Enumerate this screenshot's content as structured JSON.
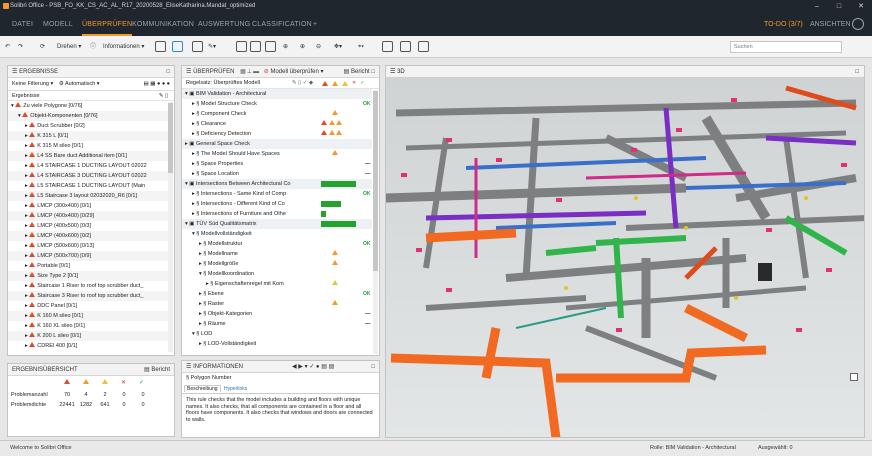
{
  "app_title": "Solibri Office - PSB_FO_KK_CS_AC_AL_R17_20200528_EliseKatharina.Mandat_optimized",
  "menu": {
    "tabs": [
      "DATEI",
      "MODELL",
      "ÜBERPRÜFEN",
      "KOMMUNIKATION",
      "AUSWERTUNG",
      "CLASSIFICATION",
      "+"
    ],
    "active": "ÜBERPRÜFEN",
    "todo": "TO-DO (3/7)",
    "ansichten": "ANSICHTEN"
  },
  "toolbar": {
    "drehen": "Drehen",
    "informationen": "Informationen",
    "search_placeholder": "Suchen"
  },
  "ergebnisse": {
    "title": "ERGEBNISSE",
    "filter": "Keine Filterung",
    "mode": "Automatisch",
    "header": "Ergebnisse",
    "rows": [
      "Zu viele Polygone [0/76]",
      "Objekt-Komponenten [0/76]",
      "Duct Scrubber [0/2]",
      "K 315 L [0/1]",
      "K 315 M sileo [0/1]",
      "L4 SS Bare duct Additional item [0/1]",
      "L4 STAIRCASE 1 DUCTING LAYOUT 02022",
      "L4 STAIRCASE 3 DUCTING LAYOUT 02022",
      "L5 STAIRCASE 1 DUCTING LAYOUT (Main",
      "L5 Staircase 3 layout 02032020_R6 [0/1]",
      "LMCP (300x400) [0/1]",
      "LMCP (400x400) [0/29]",
      "LMCP (400x500) [0/3]",
      "LMCP (400x600) [0/2]",
      "LMCP (500x600) [0/13]",
      "LMCP (500x700) [0/9]",
      "Portable [0/1]",
      "Size Type 2 [0/1]",
      "Staircase 1 Riser to roof top scrubber duct_",
      "Staircase 3 Riser to roof top scrubber duct_",
      "DDC Panel [0/1]",
      "K 160 M sileo [0/1]",
      "K 160 XL sileo [0/1]",
      "K 200 L sileo [0/1]",
      "CDREI 400 [0/1]"
    ]
  },
  "summary": {
    "title": "ERGEBNISÜBERSICHT",
    "bericht": "Bericht",
    "rows": [
      {
        "label": "Problemanzahl",
        "v": [
          "70",
          "4",
          "2",
          "0",
          "0"
        ]
      },
      {
        "label": "Problemdichte",
        "v": [
          "22441",
          "1282",
          "641",
          "0",
          "0"
        ]
      }
    ]
  },
  "check": {
    "title": "ÜBERPRÜFEN",
    "model_btn": "Modell überprüfen",
    "bericht": "Bericht",
    "header": "Regelsatz: Überprüftes Modell",
    "rows": [
      {
        "label": "BIM Validation - Architectural",
        "lvl": 0,
        "s": ""
      },
      {
        "label": "Model Structure Check",
        "lvl": 1,
        "s": "ok"
      },
      {
        "label": "Component Check",
        "lvl": 1,
        "s": "o"
      },
      {
        "label": "Clearance",
        "lvl": 1,
        "s": "roo"
      },
      {
        "label": "Deficiency Detection",
        "lvl": 1,
        "s": "roo"
      },
      {
        "label": "General Space Check",
        "lvl": 0,
        "s": ""
      },
      {
        "label": "The Model Should Have Spaces",
        "lvl": 1,
        "s": "o"
      },
      {
        "label": "Space Properties",
        "lvl": 1,
        "s": "-"
      },
      {
        "label": "Space Location",
        "lvl": 1,
        "s": "-"
      },
      {
        "label": "Intersections Between Architectural Co",
        "lvl": 0,
        "s": "bar70"
      },
      {
        "label": "Intersections - Same Kind of Comp",
        "lvl": 1,
        "s": "ok"
      },
      {
        "label": "Intersections - Different Kind of Co",
        "lvl": 1,
        "s": "bar40"
      },
      {
        "label": "Intersections of Furniture and Othe",
        "lvl": 1,
        "s": "bar10"
      },
      {
        "label": "TÜV Süd Qualitätsmatrix",
        "lvl": 0,
        "s": "bar70"
      },
      {
        "label": "Modellvollständigkeit",
        "lvl": 1,
        "s": ""
      },
      {
        "label": "Modellstruktur",
        "lvl": 2,
        "s": "ok"
      },
      {
        "label": "Modellname",
        "lvl": 2,
        "s": "o"
      },
      {
        "label": "Modellgröße",
        "lvl": 2,
        "s": "o"
      },
      {
        "label": "Modellkoordination",
        "lvl": 2,
        "s": ""
      },
      {
        "label": "Eigenschaftenregel mit Kom",
        "lvl": 3,
        "s": "y"
      },
      {
        "label": "Ebene",
        "lvl": 2,
        "s": "ok"
      },
      {
        "label": "Raster",
        "lvl": 2,
        "s": "o"
      },
      {
        "label": "Objekt-Kategorien",
        "lvl": 2,
        "s": "-"
      },
      {
        "label": "Räume",
        "lvl": 2,
        "s": "-"
      },
      {
        "label": "LOD",
        "lvl": 1,
        "s": ""
      },
      {
        "label": "LOD-Vollständigkeit",
        "lvl": 2,
        "s": ""
      }
    ]
  },
  "info": {
    "title": "INFORMATIONEN",
    "item": "Polygon Number",
    "tabs": [
      "Beschreibung",
      "Hyperlinks"
    ],
    "text": "This rule checks that the model includes a building and floors with unique names. It also checks, that all components are contained in a floor and all floors have components. It also checks that windows and doors are connected to walls."
  },
  "view3d": {
    "title": "3D"
  },
  "status": {
    "left": "Welcome to Solibri Office",
    "role": "Rolle: BIM Validation - Architectural",
    "selected": "Ausgewählt: 0"
  }
}
